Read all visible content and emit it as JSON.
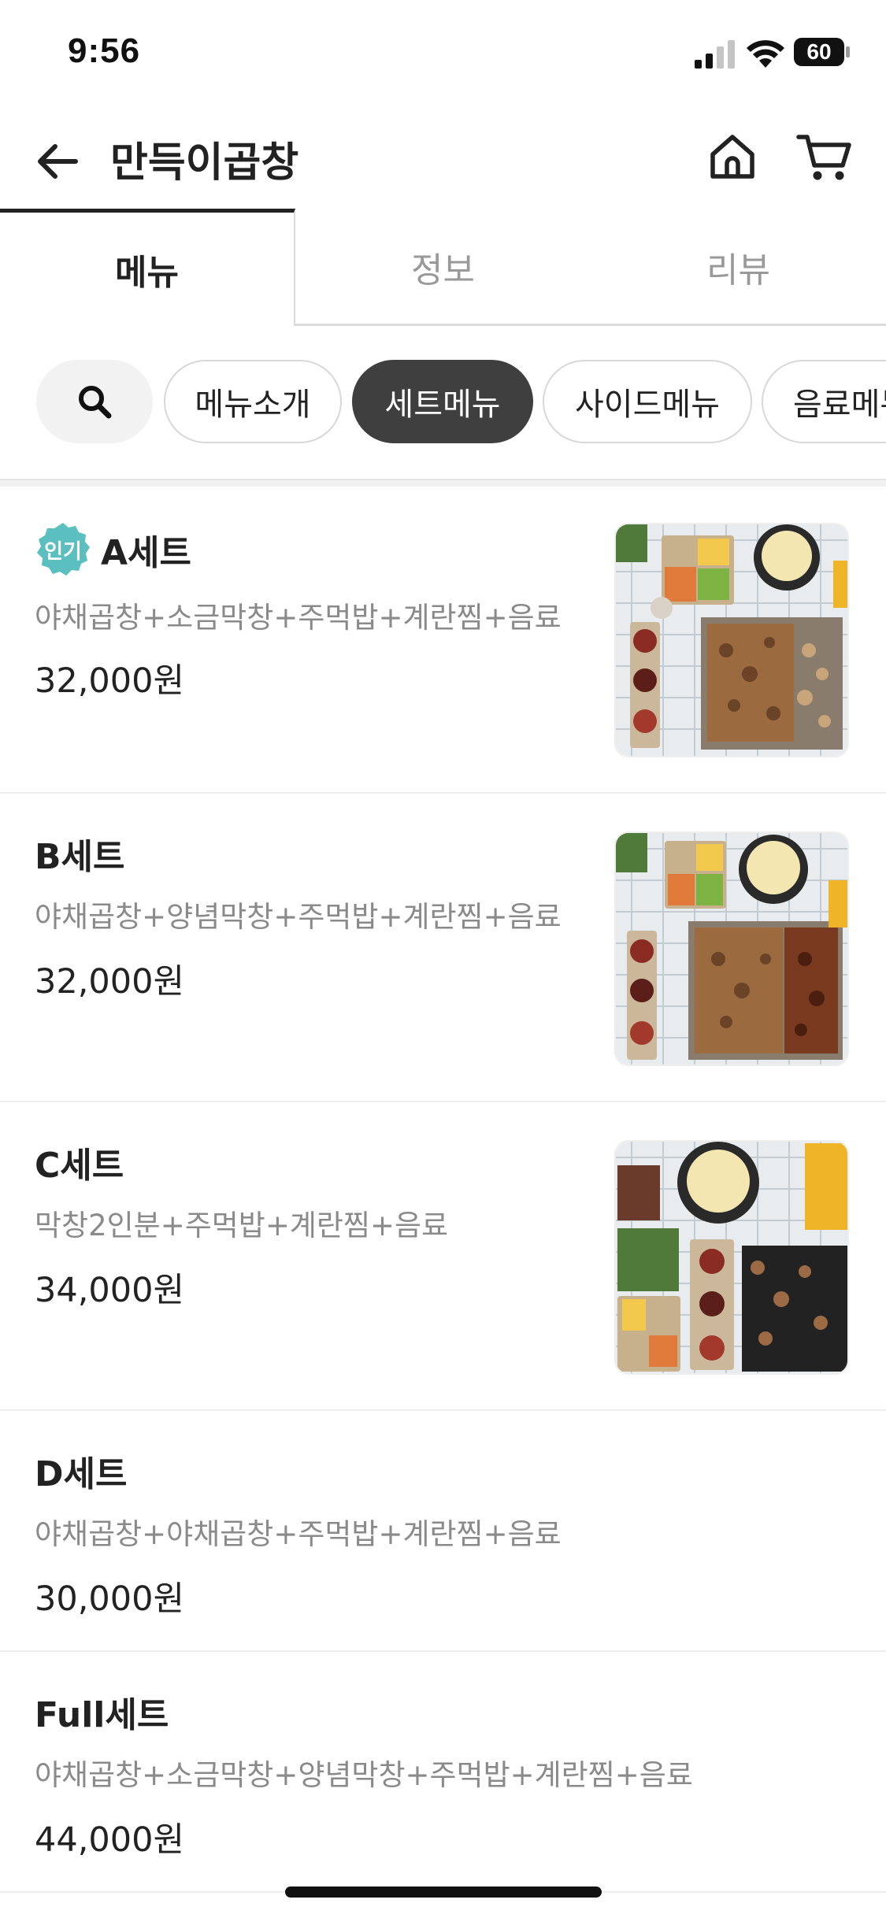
{
  "status_bar": {
    "time": "9:56",
    "battery": "60"
  },
  "header": {
    "title": "만득이곱창",
    "back_icon": "back-arrow-icon",
    "home_icon": "home-icon",
    "cart_icon": "cart-icon"
  },
  "tabs": [
    {
      "label": "메뉴",
      "active": true
    },
    {
      "label": "정보",
      "active": false
    },
    {
      "label": "리뷰",
      "active": false
    }
  ],
  "categories": [
    {
      "label": "메뉴소개",
      "active": false
    },
    {
      "label": "세트메뉴",
      "active": true
    },
    {
      "label": "사이드메뉴",
      "active": false
    },
    {
      "label": "음료메뉴",
      "active": false
    }
  ],
  "badge_label": "인기",
  "menu": [
    {
      "name": "A세트",
      "description": "야채곱창+소금막창+주먹밥+계란찜+음료",
      "price": "32,000원",
      "popular": true,
      "has_image": true
    },
    {
      "name": "B세트",
      "description": "야채곱창+양념막창+주먹밥+계란찜+음료",
      "price": "32,000원",
      "popular": false,
      "has_image": true
    },
    {
      "name": "C세트",
      "description": "막창2인분+주먹밥+계란찜+음료",
      "price": "34,000원",
      "popular": false,
      "has_image": true
    },
    {
      "name": "D세트",
      "description": "야채곱창+야채곱창+주먹밥+계란찜+음료",
      "price": "30,000원",
      "popular": false,
      "has_image": false
    },
    {
      "name": "Full세트",
      "description": "야채곱창+소금막창+양념막창+주먹밥+계란찜+음료",
      "price": "44,000원",
      "popular": false,
      "has_image": false
    }
  ],
  "colors": {
    "badge": "#5bbfc0",
    "active_chip": "#3f3f3f"
  }
}
